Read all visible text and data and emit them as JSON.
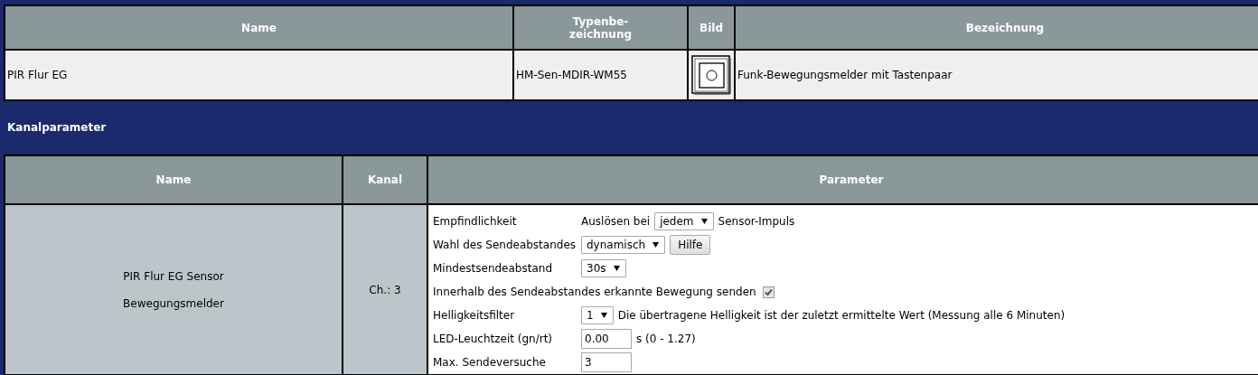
{
  "device_table": {
    "columns": [
      "Name",
      "Typenbe-\nzeichnung",
      "Bild",
      "Bezeichnung"
    ],
    "rows": [
      {
        "name": "PIR Flur EG",
        "type": "HM-Sen-MDIR-WM55",
        "description": "Funk-Bewegungsmelder mit Tastenpaar"
      }
    ]
  },
  "section_title": "Kanalparameter",
  "channel_table": {
    "columns": [
      "Name",
      "Kanal",
      "Parameter"
    ],
    "rows": [
      {
        "name_lines": [
          "PIR Flur EG Sensor",
          "Bewegungsmelder"
        ],
        "channel": "Ch.: 3",
        "parameters": [
          {
            "kind": "labeled",
            "label": "Empfindlichkeit",
            "controls": [
              {
                "kind": "text",
                "text": "Auslösen bei"
              },
              {
                "kind": "select",
                "value": "jedem"
              },
              {
                "kind": "text",
                "text": "Sensor-Impuls"
              }
            ]
          },
          {
            "kind": "labeled",
            "label": "Wahl des Sendeabstandes",
            "controls": [
              {
                "kind": "select",
                "value": "dynamisch"
              },
              {
                "kind": "button",
                "label": "Hilfe"
              }
            ]
          },
          {
            "kind": "labeled",
            "label": "Mindestsendeabstand",
            "controls": [
              {
                "kind": "select",
                "value": "30s"
              }
            ]
          },
          {
            "kind": "inline",
            "label": "Innerhalb des Sendeabstandes erkannte Bewegung senden",
            "controls": [
              {
                "kind": "checkbox",
                "checked": true
              }
            ]
          },
          {
            "kind": "labeled",
            "label": "Helligkeitsfilter",
            "controls": [
              {
                "kind": "select",
                "value": "1"
              },
              {
                "kind": "text",
                "text": "Die übertragene Helligkeit ist der zuletzt ermittelte Wert (Messung alle 6 Minuten)"
              }
            ]
          },
          {
            "kind": "labeled",
            "label": "LED-Leuchtzeit (gn/rt)",
            "controls": [
              {
                "kind": "input",
                "value": "0.00"
              },
              {
                "kind": "text",
                "text": "s (0 - 1.27)"
              }
            ]
          },
          {
            "kind": "labeled",
            "label": "Max. Sendeversuche",
            "controls": [
              {
                "kind": "input",
                "value": "3"
              }
            ]
          }
        ]
      }
    ]
  }
}
